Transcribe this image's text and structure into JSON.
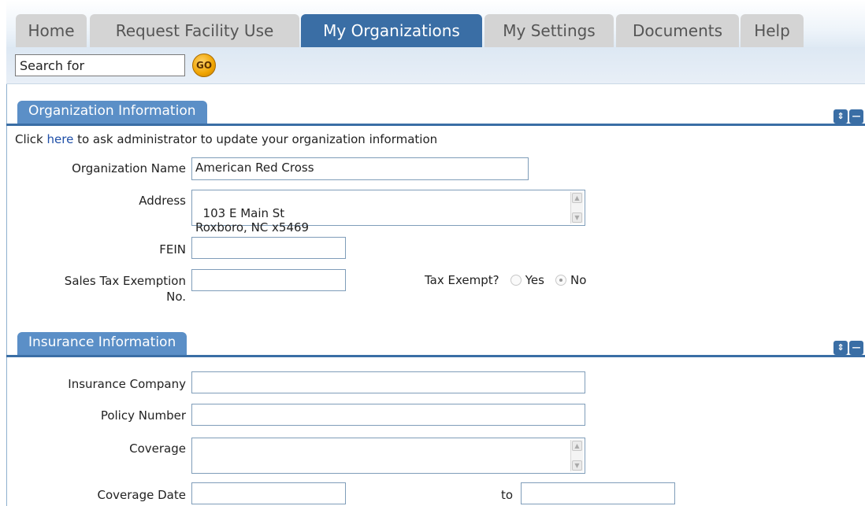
{
  "tabs": [
    {
      "label": "Home",
      "active": false
    },
    {
      "label": "Request Facility Use",
      "active": false
    },
    {
      "label": "My Organizations",
      "active": true
    },
    {
      "label": "My Settings",
      "active": false
    },
    {
      "label": "Documents",
      "active": false
    },
    {
      "label": "Help",
      "active": false
    }
  ],
  "search": {
    "value": "Search for",
    "go_label": "GO"
  },
  "org_section": {
    "title": "Organization Information",
    "notice_prefix": "Click ",
    "notice_link": "here",
    "notice_suffix": " to ask administrator to update your organization information",
    "name_label": "Organization Name",
    "name_value": "American Red Cross",
    "address_label": "Address",
    "address_value": "103 E Main St\nRoxboro, NC x5469",
    "fein_label": "FEIN",
    "fein_value": "",
    "sales_tax_label_1": "Sales Tax Exemption",
    "sales_tax_label_2": "No.",
    "sales_tax_value": "",
    "tax_exempt_label": "Tax Exempt?",
    "yes_label": "Yes",
    "no_label": "No",
    "tax_exempt_selected": "No"
  },
  "ins_section": {
    "title": "Insurance Information",
    "company_label": "Insurance Company",
    "company_value": "",
    "policy_label": "Policy Number",
    "policy_value": "",
    "coverage_label": "Coverage",
    "coverage_value": "",
    "date_label": "Coverage Date",
    "date_from": "",
    "to_label": "to",
    "date_to": ""
  },
  "colors": {
    "accent": "#3a6ea5",
    "section_tab": "#5b8fc7",
    "tab_inactive": "#d4d4d4"
  },
  "icons": {
    "go": "go-button-icon",
    "expand": "expand-icon",
    "collapse": "collapse-icon",
    "scroll_up": "scroll-up-icon",
    "scroll_down": "scroll-down-icon"
  }
}
